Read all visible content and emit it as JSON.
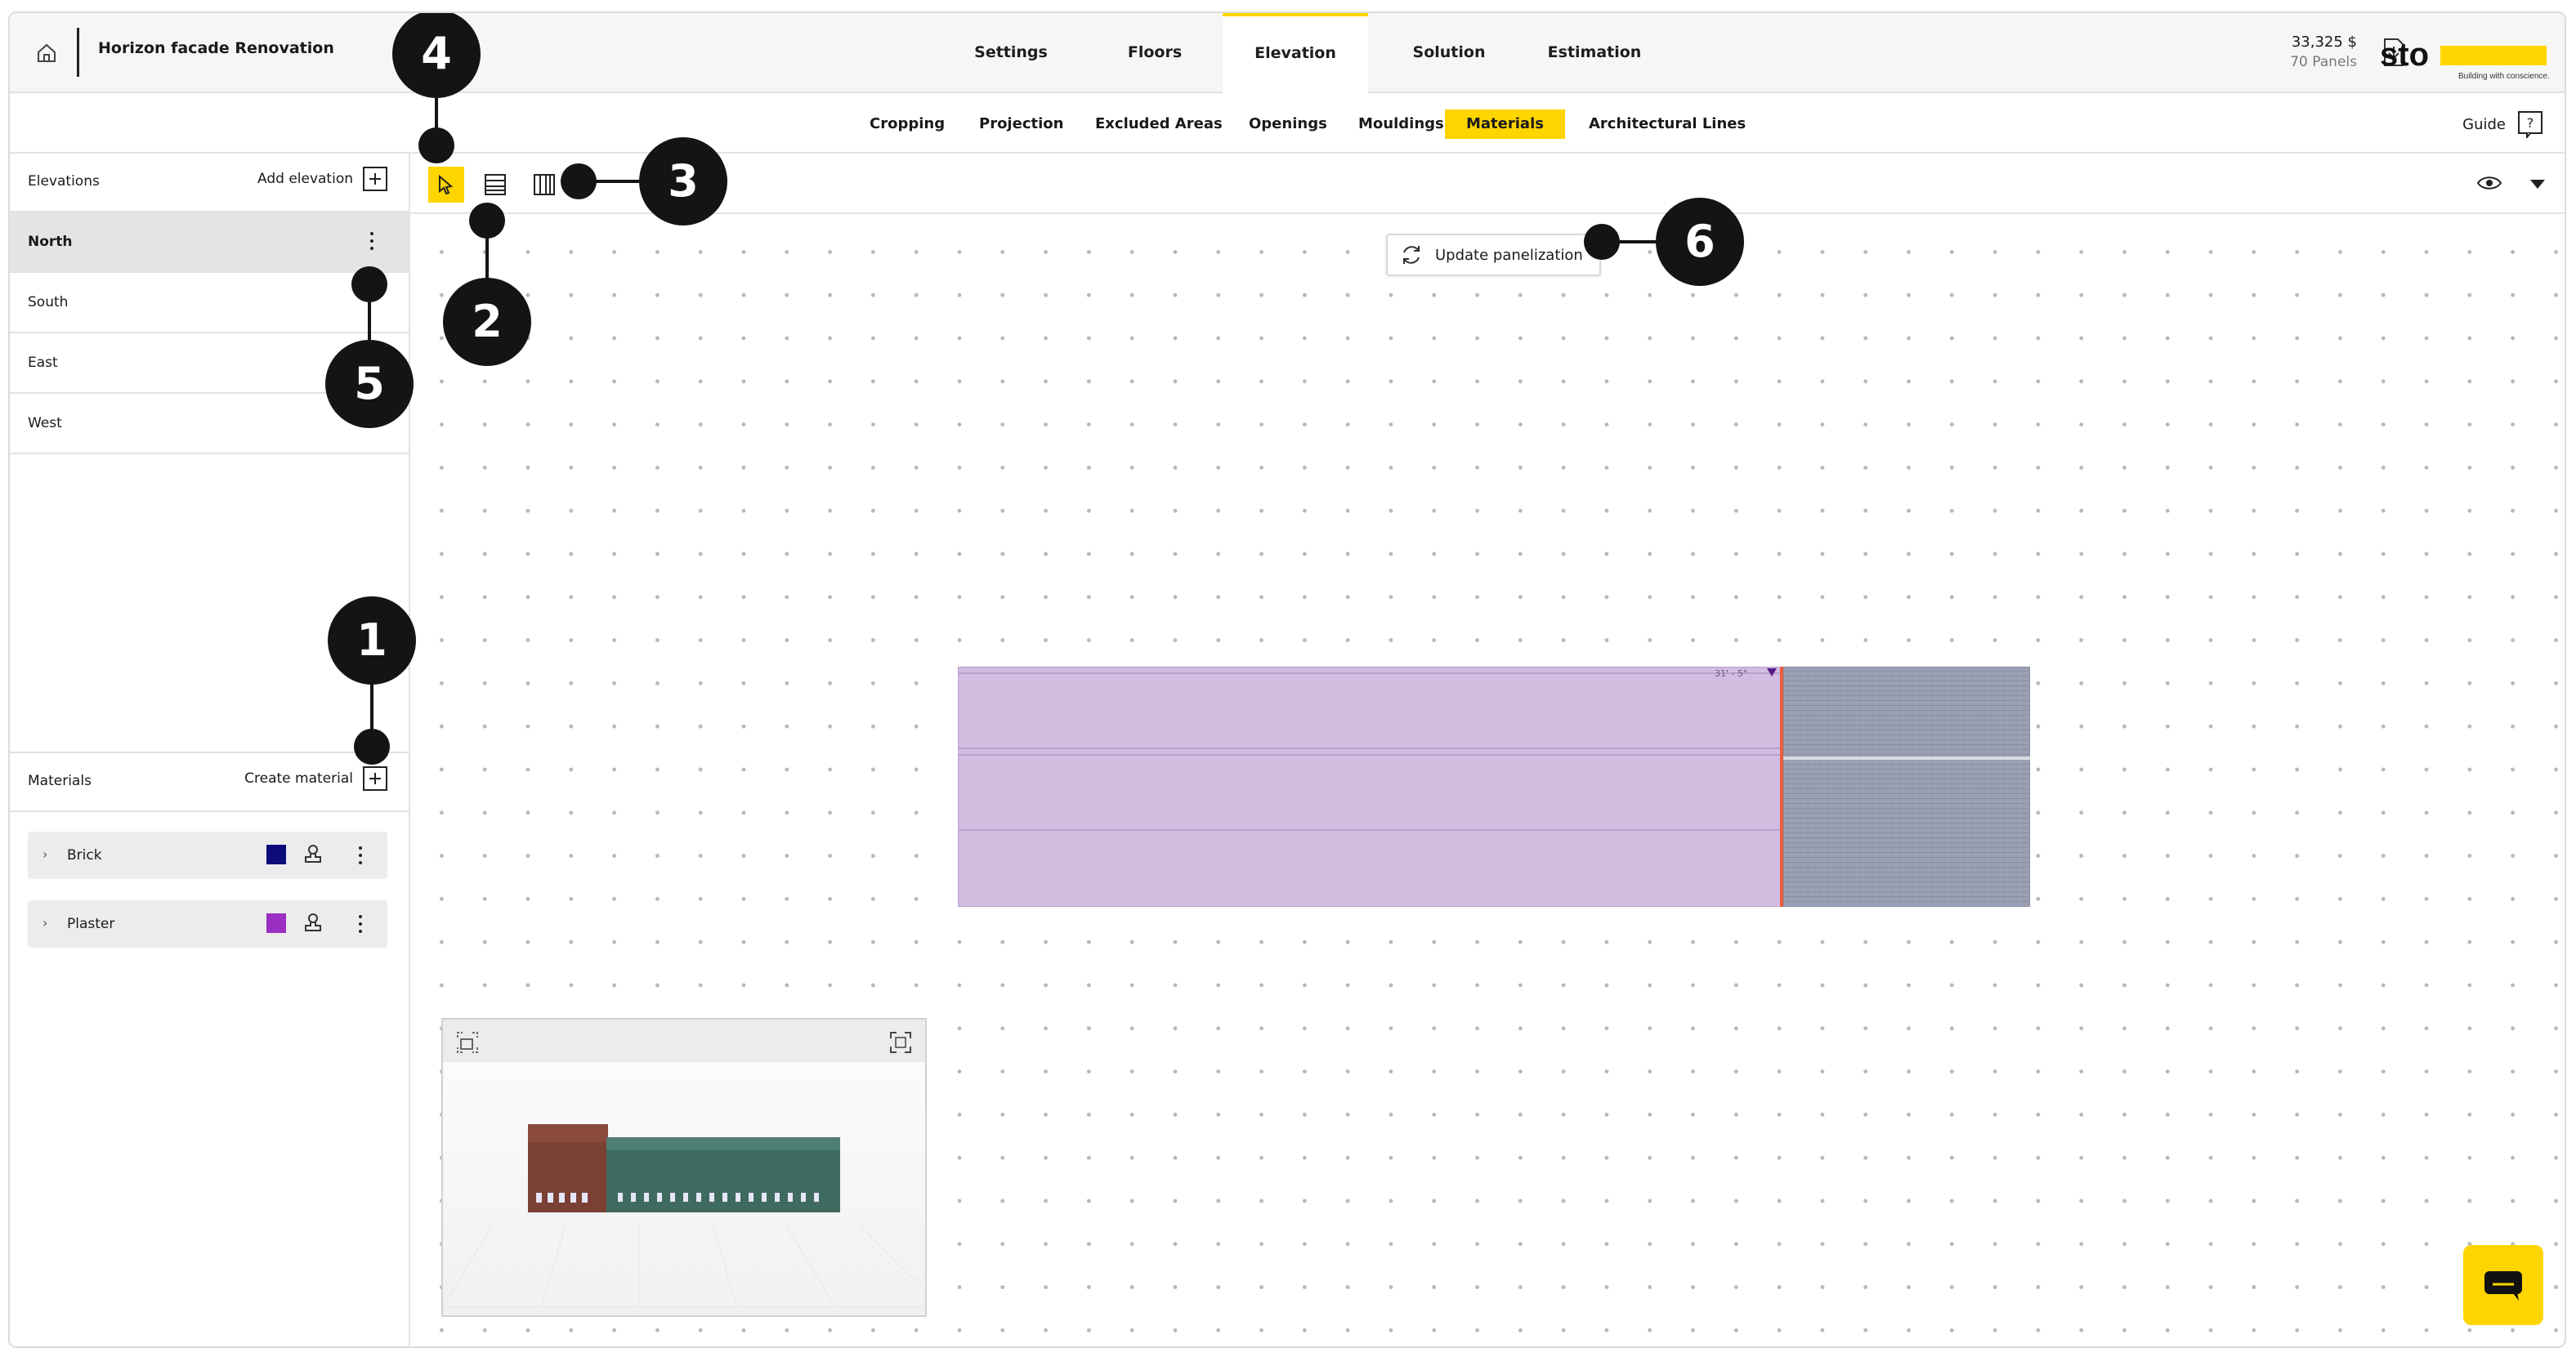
{
  "header": {
    "project_title": "Horizon facade Renovation",
    "tabs": [
      {
        "label": "Settings"
      },
      {
        "label": "Floors"
      },
      {
        "label": "Elevation",
        "active": true
      },
      {
        "label": "Solution"
      },
      {
        "label": "Estimation"
      }
    ],
    "price": "33,325 $",
    "panels": "70 Panels",
    "brand_name": "sto",
    "brand_tagline": "Building with conscience.",
    "brand_color": "#ffd500"
  },
  "subnav": {
    "tabs": [
      {
        "label": "Cropping"
      },
      {
        "label": "Projection"
      },
      {
        "label": "Excluded Areas"
      },
      {
        "label": "Openings"
      },
      {
        "label": "Mouldings"
      },
      {
        "label": "Materials",
        "active": true
      },
      {
        "label": "Architectural Lines"
      }
    ],
    "guide_label": "Guide",
    "guide_icon": "?"
  },
  "elevations": {
    "title": "Elevations",
    "add_label": "Add elevation",
    "items": [
      {
        "label": "North",
        "selected": true
      },
      {
        "label": "South"
      },
      {
        "label": "East"
      },
      {
        "label": "West"
      }
    ]
  },
  "materials": {
    "title": "Materials",
    "create_label": "Create material",
    "items": [
      {
        "label": "Brick",
        "color": "#0b0b7a"
      },
      {
        "label": "Plaster",
        "color": "#9b2fc4"
      }
    ]
  },
  "toolbar": {
    "tools": [
      "select-cursor-icon",
      "horizontal-panel-icon",
      "vertical-panel-icon"
    ],
    "active_tool": "select-cursor-icon"
  },
  "canvas": {
    "update_label": "Update panelization",
    "dimension_label": "31' - 5\"",
    "plaster_fill": "#d2bce0",
    "brick_fill": "#9a9eb2",
    "divider_color": "#e8603c"
  },
  "callouts": [
    "1",
    "2",
    "3",
    "4",
    "5",
    "6"
  ]
}
